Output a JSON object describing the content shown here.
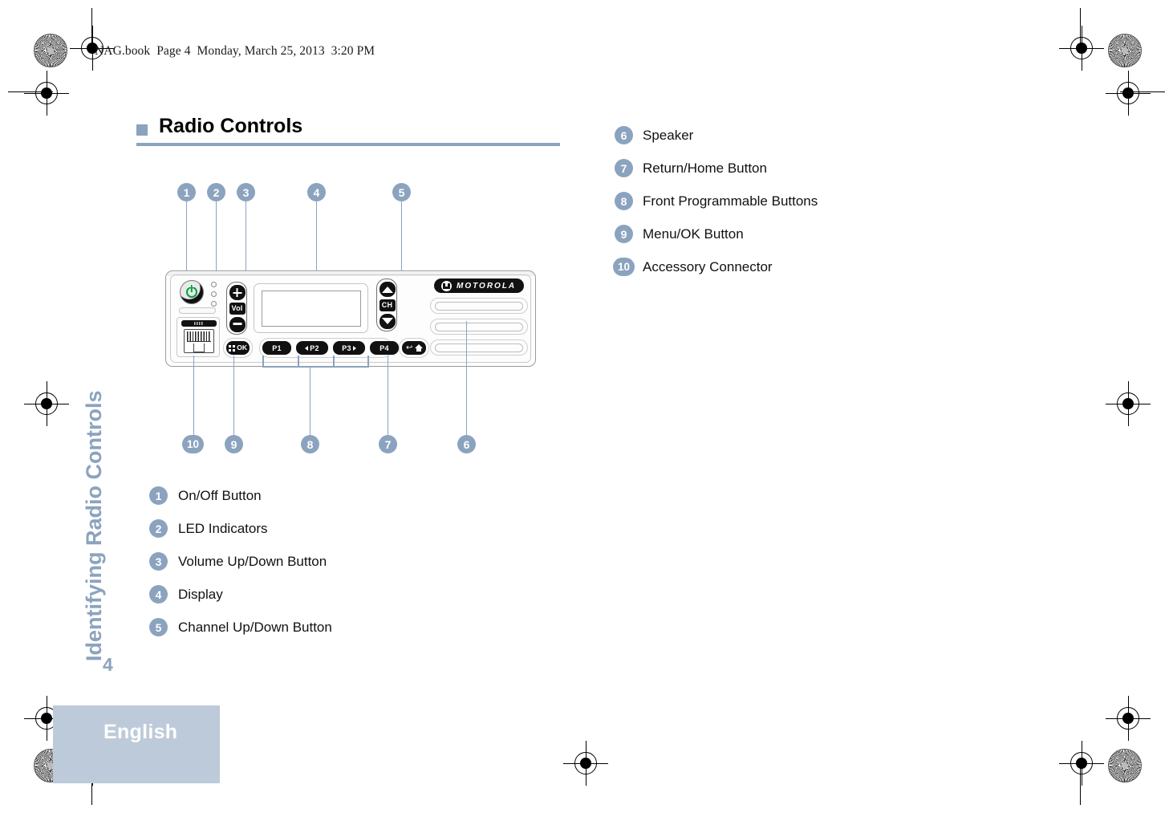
{
  "document": {
    "header_line": "NAG.book  Page 4  Monday, March 25, 2013  3:20 PM",
    "running_head": "Identifying Radio Controls",
    "page_number": "4",
    "language_footer": "English"
  },
  "section": {
    "title": "Radio Controls"
  },
  "callouts_top": [
    {
      "number": "1"
    },
    {
      "number": "2"
    },
    {
      "number": "3"
    },
    {
      "number": "4"
    },
    {
      "number": "5"
    }
  ],
  "callouts_bottom": [
    {
      "number": "10"
    },
    {
      "number": "9"
    },
    {
      "number": "8"
    },
    {
      "number": "7"
    },
    {
      "number": "6"
    }
  ],
  "legend_left": [
    {
      "number": "1",
      "label": "On/Off Button"
    },
    {
      "number": "2",
      "label": "LED Indicators"
    },
    {
      "number": "3",
      "label": "Volume Up/Down Button"
    },
    {
      "number": "4",
      "label": "Display"
    },
    {
      "number": "5",
      "label": "Channel Up/Down Button"
    }
  ],
  "legend_right": [
    {
      "number": "6",
      "label": "Speaker"
    },
    {
      "number": "7",
      "label": "Return/Home Button"
    },
    {
      "number": "8",
      "label": "Front Programmable Buttons"
    },
    {
      "number": "9",
      "label": "Menu/OK Button"
    },
    {
      "number": "10",
      "label": "Accessory Connector"
    }
  ],
  "radio": {
    "brand_text": "MOTOROLA",
    "volume_label": "Vol",
    "channel_label": "CH",
    "ok_label": "OK",
    "programmable_buttons": [
      "P1",
      "P2",
      "P3",
      "P4"
    ],
    "back_glyph": "↩"
  },
  "colors": {
    "accent": "#8ba3be",
    "footer_block": "#bdcad9",
    "power_led": "#00a03b",
    "text": "#111111"
  }
}
